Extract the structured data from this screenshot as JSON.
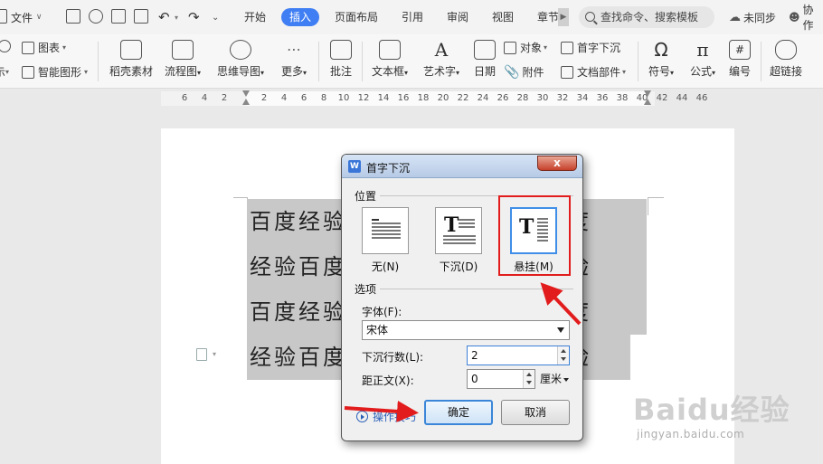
{
  "titlebar": {
    "file_menu": "文件",
    "tabs": [
      "开始",
      "插入",
      "页面布局",
      "引用",
      "审阅",
      "视图",
      "章节"
    ],
    "active_tab": "插入",
    "search_placeholder": "查找命令、搜索模板",
    "sync_status": "未同步",
    "collab": "协作"
  },
  "ribbon": {
    "left_partial_label": "示",
    "chart_label": "图表",
    "smart_shape_label": "智能图形",
    "big_buttons": [
      "稻壳素材",
      "流程图",
      "思维导图",
      "更多",
      "批注",
      "文本框",
      "艺术字",
      "日期",
      "符号",
      "公式",
      "编号",
      "超链接"
    ],
    "object_label": "对象",
    "dropcap_label": "首字下沉",
    "attachment_label": "附件",
    "docparts_label": "文档部件"
  },
  "ruler": {
    "labels": [
      "6",
      "4",
      "2",
      "2",
      "4",
      "6",
      "8",
      "10",
      "12",
      "14",
      "16",
      "18",
      "20",
      "22",
      "24",
      "26",
      "28",
      "30",
      "32",
      "34",
      "36",
      "38",
      "40",
      "42",
      "44",
      "46"
    ]
  },
  "document": {
    "lines": [
      "百度经验百度经验百度经验百度",
      "经验百度经验百度经验百度经验",
      "百度经验百度经验百度经验百度",
      "经验百度经验百度经验百度经验"
    ]
  },
  "dialog": {
    "title": "首字下沉",
    "close_label": "x",
    "position_group": "位置",
    "options": [
      {
        "label": "无(N)",
        "selected": false
      },
      {
        "label": "下沉(D)",
        "selected": false
      },
      {
        "label": "悬挂(M)",
        "selected": true
      }
    ],
    "options_group": "选项",
    "font_label": "字体(F):",
    "font_value": "宋体",
    "lines_label": "下沉行数(L):",
    "lines_value": "2",
    "distance_label": "距正文(X):",
    "distance_value": "0",
    "unit_value": "厘米",
    "tips_label": "操作技巧",
    "ok_label": "确定",
    "cancel_label": "取消"
  },
  "annotation": {
    "highlight_color": "#e21c1c"
  },
  "watermark": {
    "logo": "Baidu经验",
    "url": "jingyan.baidu.com"
  },
  "colors": {
    "accent": "#3f7ef3",
    "selection": "#c8c8c8"
  }
}
